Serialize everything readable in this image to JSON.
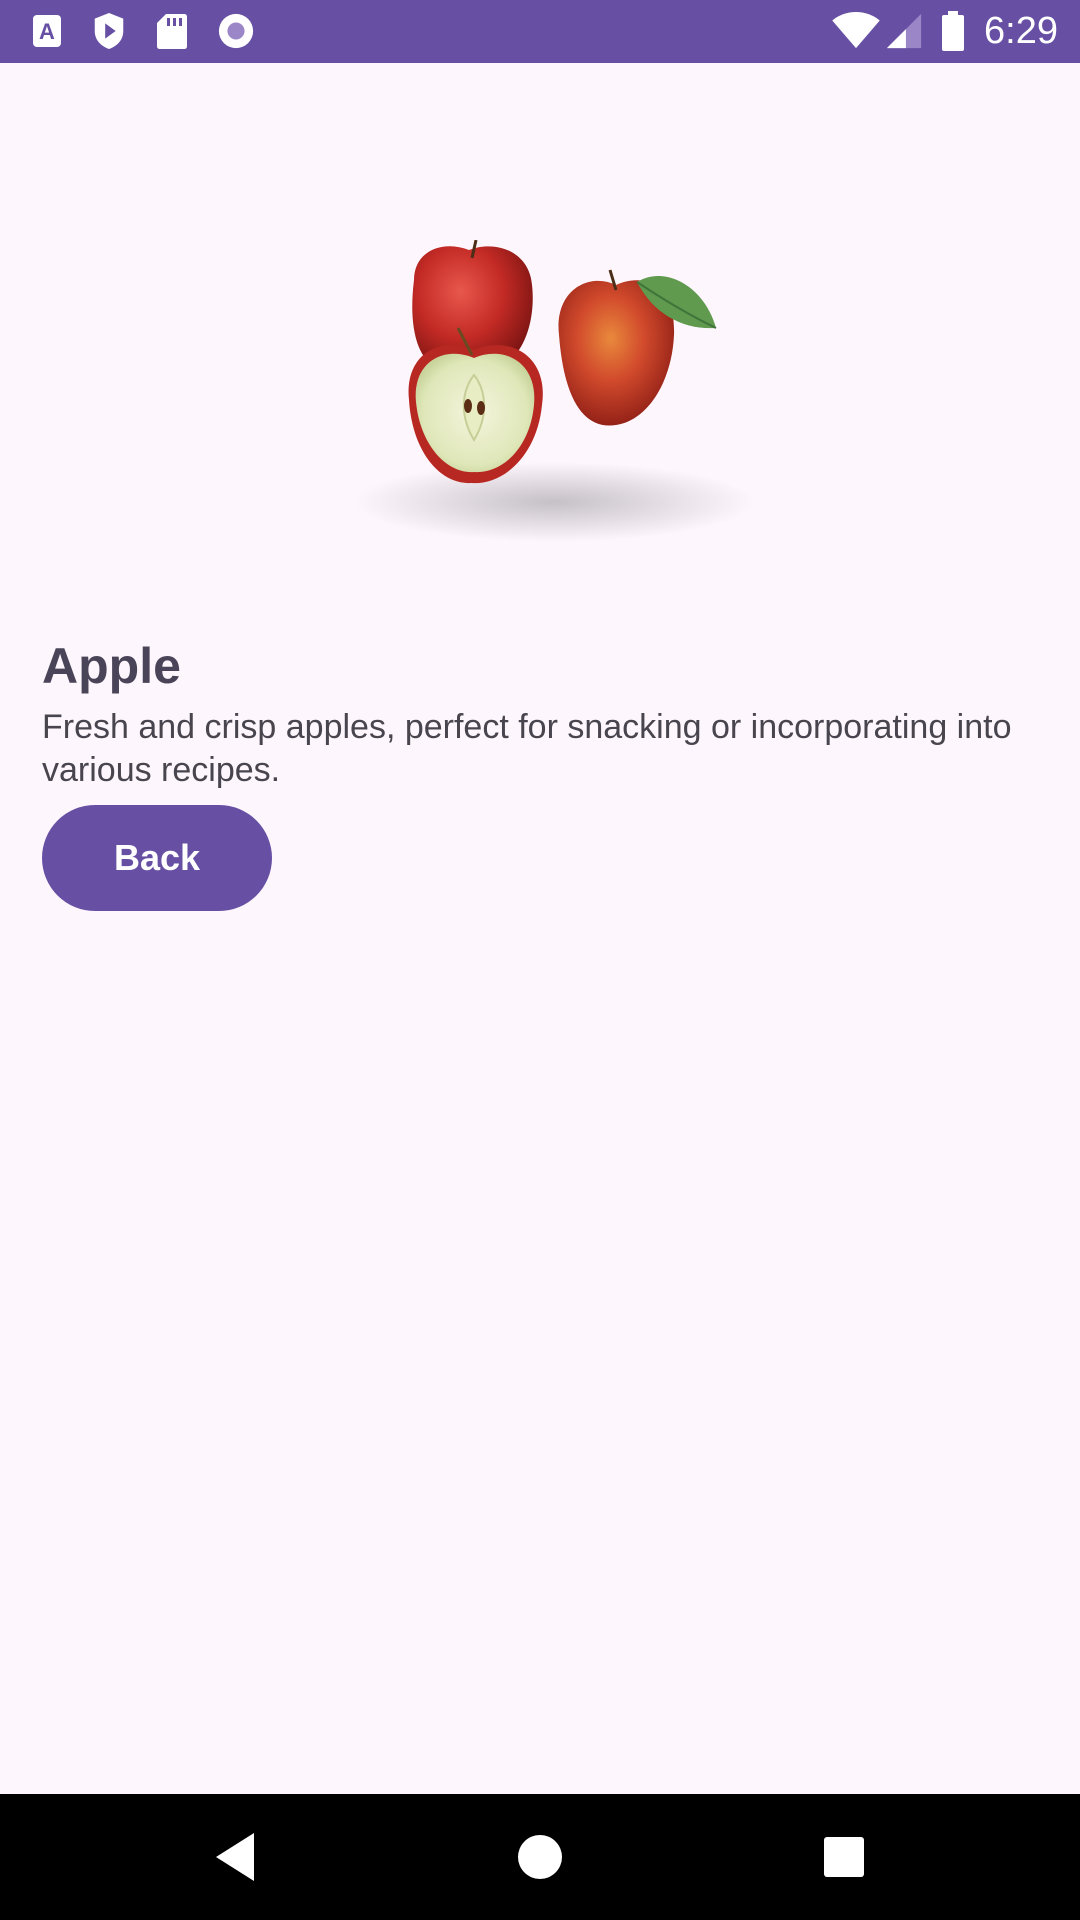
{
  "status_bar": {
    "time": "6:29",
    "icons_left": [
      "accessibility-a-icon",
      "shield-play-icon",
      "sd-card-icon",
      "record-circle-icon"
    ],
    "icons_right": [
      "wifi-icon",
      "cellular-signal-icon",
      "battery-icon"
    ],
    "color": "#6750a4"
  },
  "product": {
    "image": "apple-image",
    "name": "Apple",
    "description": "Fresh and crisp apples, perfect for snacking or incorporating into various recipes."
  },
  "actions": {
    "back_label": "Back"
  },
  "nav_bar": {
    "buttons": [
      "back-triangle-icon",
      "home-circle-icon",
      "recents-square-icon"
    ]
  },
  "colors": {
    "accent": "#6750a4",
    "background": "#fdf7fd",
    "title_text": "#4a4458",
    "body_text": "#49454f"
  }
}
